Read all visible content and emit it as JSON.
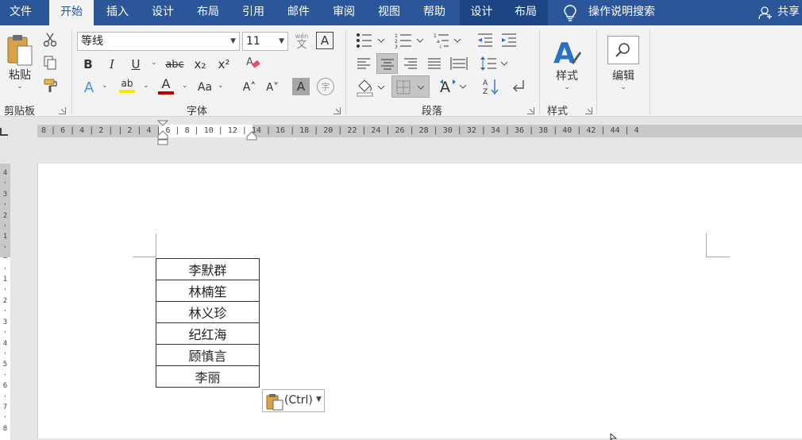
{
  "menu": {
    "tabs": [
      "文件",
      "开始",
      "插入",
      "设计",
      "布局",
      "引用",
      "邮件",
      "审阅",
      "视图",
      "帮助",
      "设计",
      "布局"
    ],
    "search_text": "操作说明搜索",
    "share_label": "共享"
  },
  "ribbon": {
    "clipboard": {
      "paste_label": "粘贴",
      "group_label": "剪贴板"
    },
    "font": {
      "font_name": "等线",
      "font_size": "11",
      "phonetic_small": "wén",
      "phonetic_main": "文",
      "bold": "B",
      "italic": "I",
      "underline": "U",
      "strike": "abc",
      "subscript": "x₂",
      "superscript": "x²",
      "text_effect": "A",
      "highlight": "ab",
      "font_color": "A",
      "change_case": "Aa",
      "grow": "A˄",
      "shrink": "A˅",
      "char_shading": "A",
      "enclose": "字",
      "group_label": "字体"
    },
    "paragraph": {
      "group_label": "段落"
    },
    "styles": {
      "button_label": "样式",
      "group_label": "样式"
    },
    "editing": {
      "button_label": "编辑"
    }
  },
  "ruler": {
    "text": "8 | 6 | 4 | 2 |  |   2 | 4 | 6 |  8 | 10 | 12 | 14 | 16 | 18 | 20 | 22 | 24 | 26 | 28 | 30 | 32 | 34 | 36 | 38 | 40 | 42 | 44 | 4",
    "vertical_numbers": [
      "4",
      "3",
      "2",
      "1",
      "",
      "1",
      "2",
      "3",
      "4",
      "5",
      "6",
      "7",
      "8"
    ]
  },
  "document": {
    "table_rows": [
      "李默群",
      "林楠笙",
      "林义珍",
      "纪红海",
      "顾慎言",
      "李丽"
    ]
  },
  "paste_options": {
    "label": "(Ctrl)"
  },
  "colors": {
    "title_bar": "#2b579a",
    "ribbon_bg": "#f3f3f3",
    "highlight": "#ffe600",
    "font_color": "#c00000"
  }
}
